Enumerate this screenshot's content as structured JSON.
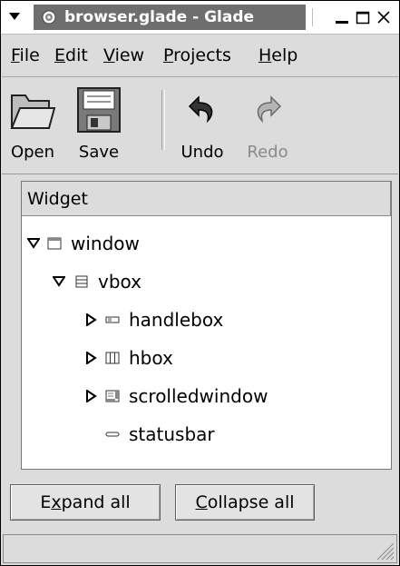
{
  "window": {
    "title": "browser.glade - Glade"
  },
  "titlebar": {
    "menu_icon": "triangle-down-icon",
    "app_icon": "glade-app-icon",
    "minimize_icon": "minimize-icon",
    "maximize_icon": "maximize-icon",
    "close_icon": "close-icon"
  },
  "menubar": {
    "items": [
      {
        "label": "File",
        "mnemonic": "F"
      },
      {
        "label": "Edit",
        "mnemonic": "E"
      },
      {
        "label": "View",
        "mnemonic": "V"
      },
      {
        "label": "Projects",
        "mnemonic": "P"
      },
      {
        "label": "Help",
        "mnemonic": "H"
      }
    ]
  },
  "toolbar": {
    "open_label": "Open",
    "save_label": "Save",
    "undo_label": "Undo",
    "redo_label": "Redo",
    "redo_disabled": true
  },
  "tree": {
    "column_header": "Widget",
    "rows": [
      {
        "label": "window",
        "icon": "window-icon",
        "expanded": true,
        "level": 0
      },
      {
        "label": "vbox",
        "icon": "vbox-icon",
        "expanded": true,
        "level": 1
      },
      {
        "label": "handlebox",
        "icon": "handlebox-icon",
        "expanded": false,
        "level": 2
      },
      {
        "label": "hbox",
        "icon": "hbox-icon",
        "expanded": false,
        "level": 2
      },
      {
        "label": "scrolledwindow",
        "icon": "scrolledwindow-icon",
        "expanded": false,
        "level": 2
      },
      {
        "label": "statusbar",
        "icon": "statusbar-icon",
        "leaf": true,
        "level": 2
      }
    ]
  },
  "buttons": {
    "expand_all_label": "Expand all",
    "expand_all_mnemonic": "x",
    "collapse_all_label": "Collapse all",
    "collapse_all_mnemonic": "C"
  },
  "statusbar": {
    "text": ""
  }
}
